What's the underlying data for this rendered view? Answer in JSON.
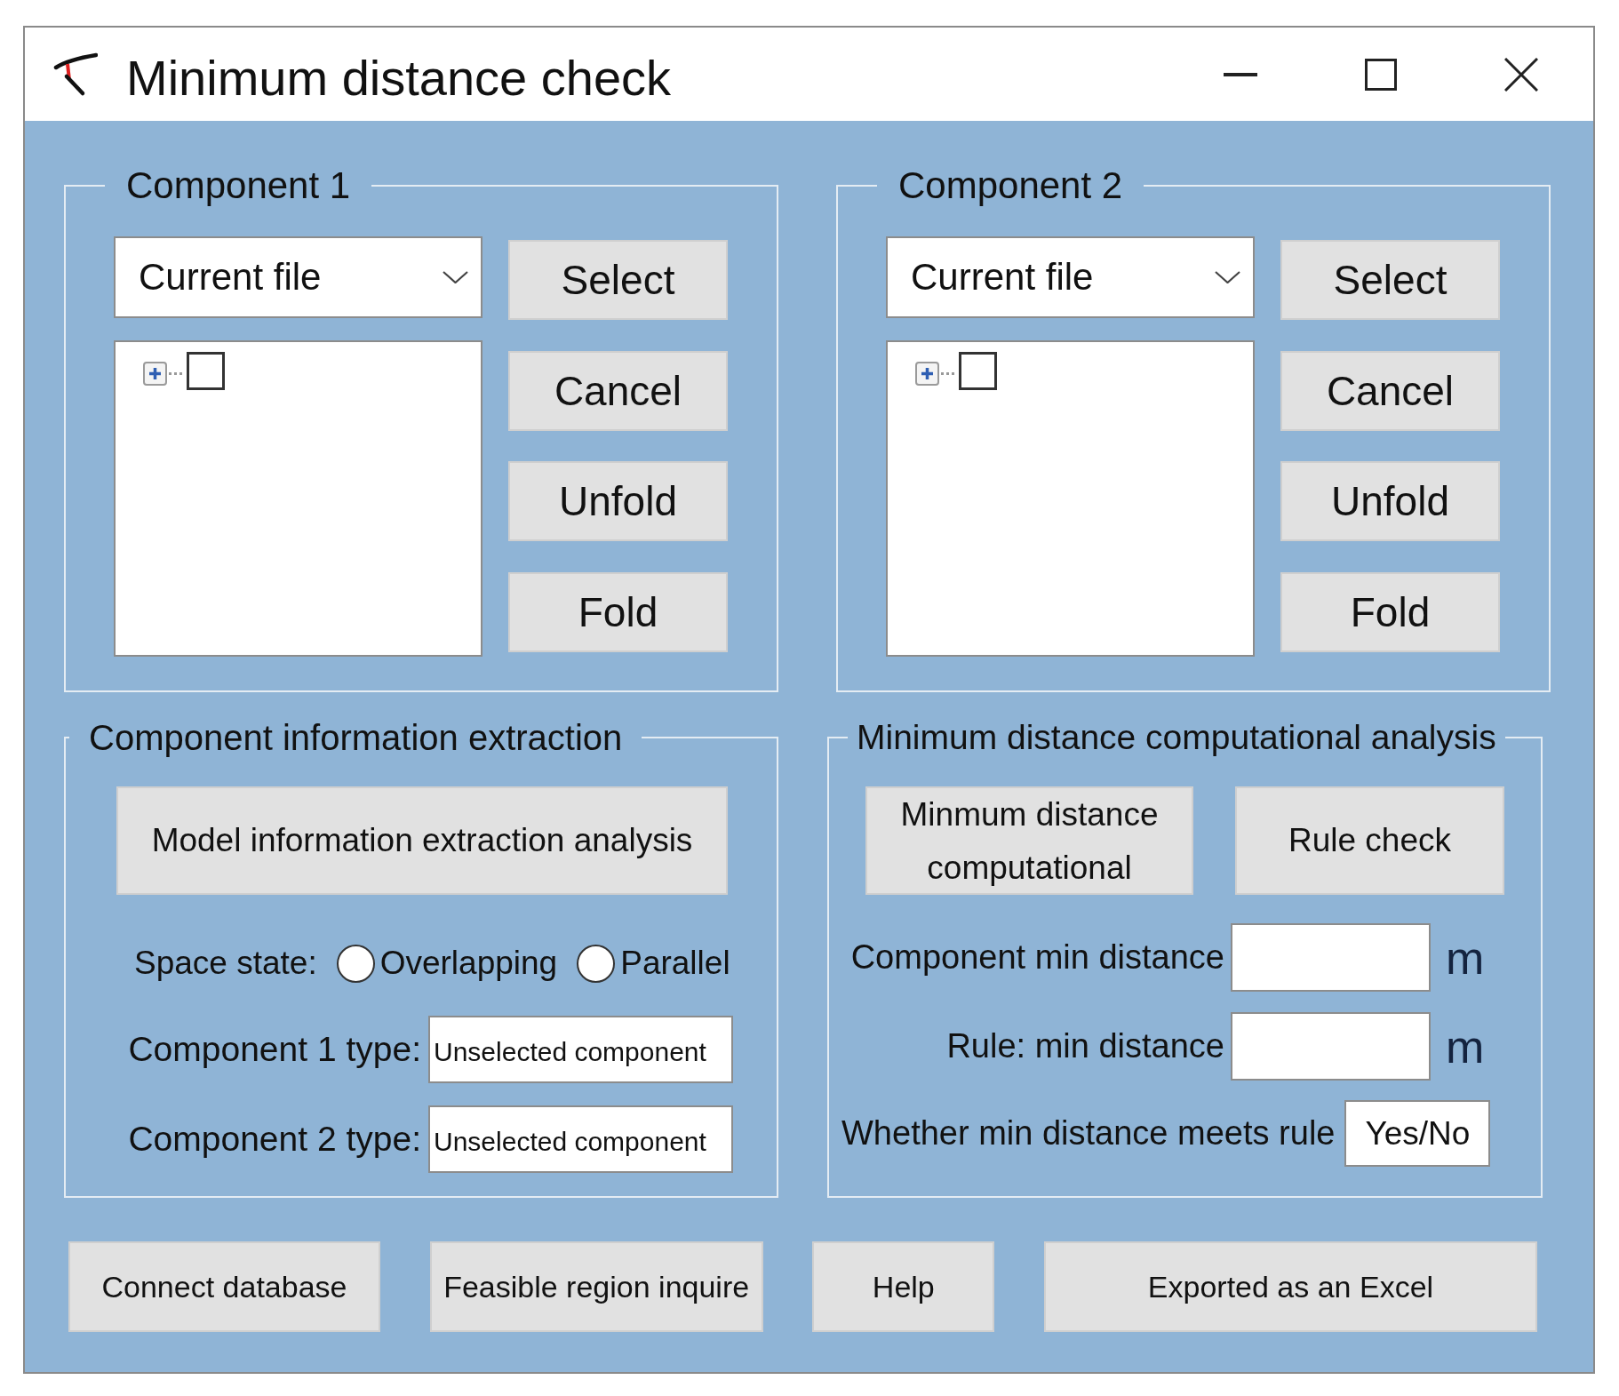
{
  "window": {
    "title": "Minimum distance check"
  },
  "component_groups": [
    {
      "title": "Component 1",
      "source_dropdown": {
        "value": "Current file"
      },
      "tree": [
        {
          "expanded": false,
          "checked": false
        }
      ],
      "buttons": [
        "Select",
        "Cancel",
        "Unfold",
        "Fold"
      ]
    },
    {
      "title": "Component 2",
      "source_dropdown": {
        "value": "Current file"
      },
      "tree": [
        {
          "expanded": false,
          "checked": false
        }
      ],
      "buttons": [
        "Select",
        "Cancel",
        "Unfold",
        "Fold"
      ]
    }
  ],
  "extraction": {
    "title": "Component information extraction",
    "button": "Model information extraction analysis",
    "space_state": {
      "label": "Space state:",
      "options": [
        {
          "label": "Overlapping",
          "selected": false
        },
        {
          "label": "Parallel",
          "selected": false
        }
      ]
    },
    "type_fields": [
      {
        "label": "Component 1 type:",
        "value": "Unselected component"
      },
      {
        "label": "Component 2 type:",
        "value": "Unselected component"
      }
    ]
  },
  "analysis": {
    "title": "Minimum distance computational analysis",
    "buttons": [
      "Minmum distance computational",
      "Rule check"
    ],
    "fields": [
      {
        "kind": "measure",
        "label": "Component min distance",
        "unit": "m"
      },
      {
        "kind": "measure",
        "label": "Rule: min distance",
        "unit": "m"
      },
      {
        "kind": "verdict",
        "label": "Whether min distance meets rule",
        "value": "Yes/No"
      }
    ]
  },
  "footer_buttons": [
    "Connect database",
    "Feasible region inquire",
    "Help",
    "Exported as an Excel"
  ]
}
